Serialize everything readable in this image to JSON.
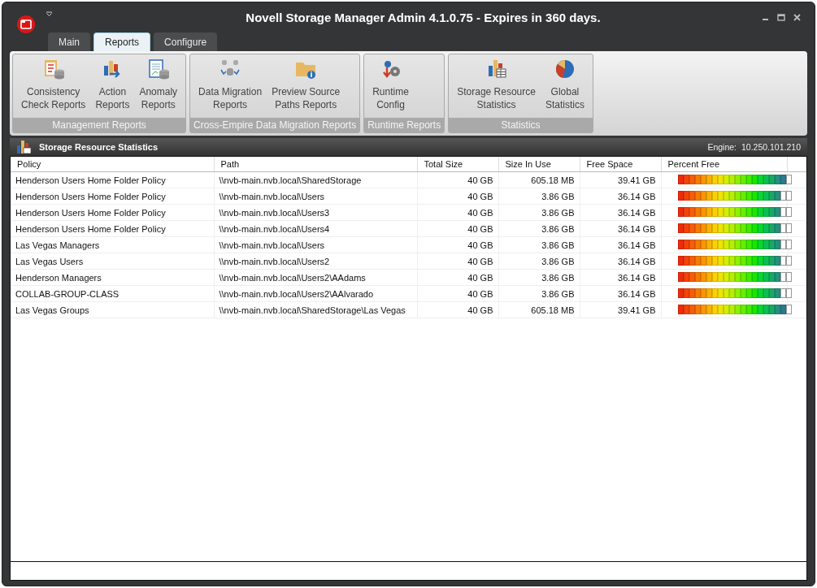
{
  "window": {
    "title": "Novell Storage Manager Admin 4.1.0.75 - Expires in 360 days."
  },
  "tabs": [
    {
      "label": "Main",
      "selected": false
    },
    {
      "label": "Reports",
      "selected": true
    },
    {
      "label": "Configure",
      "selected": false
    }
  ],
  "ribbon_groups": [
    {
      "caption": "Management Reports",
      "buttons": [
        "Consistency\nCheck Reports",
        "Action\nReports",
        "Anomaly\nReports"
      ]
    },
    {
      "caption": "Cross-Empire Data Migration Reports",
      "buttons": [
        "Data Migration\nReports",
        "Preview Source\nPaths Reports"
      ]
    },
    {
      "caption": "Runtime Reports",
      "buttons": [
        "Runtime\nConfig"
      ]
    },
    {
      "caption": "Statistics",
      "buttons": [
        "Storage Resource\nStatistics",
        "Global\nStatistics"
      ]
    }
  ],
  "panel": {
    "title": "Storage Resource Statistics",
    "engine_label": "Engine:",
    "engine": "10.250.101.210"
  },
  "table": {
    "columns": [
      "Policy",
      "Path",
      "Total Size",
      "Size In Use",
      "Free Space",
      "Percent Free"
    ],
    "rows": [
      {
        "policy": "Henderson Users Home Folder Policy",
        "path": "\\\\nvb-main.nvb.local\\SharedStorage",
        "total": "40 GB",
        "used": "605.18 MB",
        "free": "39.41 GB",
        "level": 0.985
      },
      {
        "policy": "Henderson Users Home Folder Policy",
        "path": "\\\\nvb-main.nvb.local\\Users",
        "total": "40 GB",
        "used": "3.86 GB",
        "free": "36.14 GB",
        "level": 0.9035
      },
      {
        "policy": "Henderson Users Home Folder Policy",
        "path": "\\\\nvb-main.nvb.local\\Users3",
        "total": "40 GB",
        "used": "3.86 GB",
        "free": "36.14 GB",
        "level": 0.9035
      },
      {
        "policy": "Henderson Users Home Folder Policy",
        "path": "\\\\nvb-main.nvb.local\\Users4",
        "total": "40 GB",
        "used": "3.86 GB",
        "free": "36.14 GB",
        "level": 0.9035
      },
      {
        "policy": "Las Vegas Managers",
        "path": "\\\\nvb-main.nvb.local\\Users",
        "total": "40 GB",
        "used": "3.86 GB",
        "free": "36.14 GB",
        "level": 0.9035
      },
      {
        "policy": "Las Vegas Users",
        "path": "\\\\nvb-main.nvb.local\\Users2",
        "total": "40 GB",
        "used": "3.86 GB",
        "free": "36.14 GB",
        "level": 0.9035
      },
      {
        "policy": "Henderson Managers",
        "path": "\\\\nvb-main.nvb.local\\Users2\\AAdams",
        "total": "40 GB",
        "used": "3.86 GB",
        "free": "36.14 GB",
        "level": 0.9035
      },
      {
        "policy": "COLLAB-GROUP-CLASS",
        "path": "\\\\nvb-main.nvb.local\\Users2\\AAlvarado",
        "total": "40 GB",
        "used": "3.86 GB",
        "free": "36.14 GB",
        "level": 0.9035
      },
      {
        "policy": "Las Vegas Groups",
        "path": "\\\\nvb-main.nvb.local\\SharedStorage\\Las Vegas",
        "total": "40 GB",
        "used": "605.18 MB",
        "free": "39.41 GB",
        "level": 0.985
      }
    ]
  }
}
